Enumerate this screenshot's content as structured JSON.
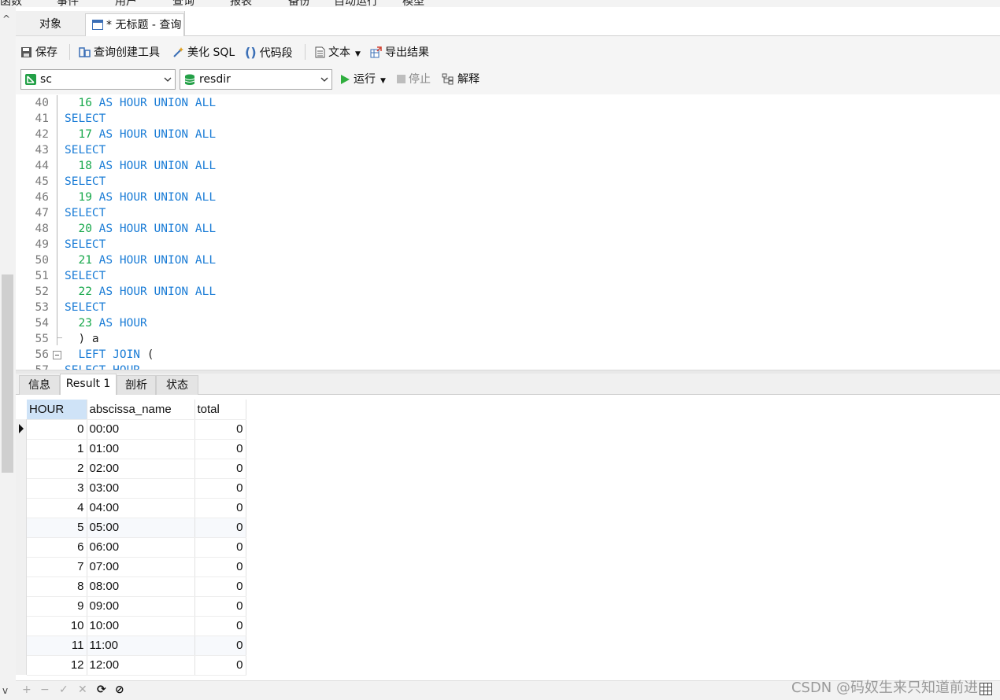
{
  "menu": [
    "函数",
    "事件",
    "用户",
    "查询",
    "报表",
    "备份",
    "自动运行",
    "模型"
  ],
  "tabs": {
    "objects": "对象",
    "query": "* 无标题 - 查询"
  },
  "toolbar": {
    "save": "保存",
    "query_builder": "查询创建工具",
    "beautify": "美化 SQL",
    "snippet": "代码段",
    "text": "文本",
    "export": "导出结果"
  },
  "toolbar2": {
    "connection": "sc",
    "database": "resdir",
    "run": "运行",
    "stop": "停止",
    "explain": "解释"
  },
  "editor_lines": [
    {
      "n": "40",
      "tokens": [
        [
          "",
          "  "
        ],
        [
          "num",
          "16"
        ],
        [
          "kw",
          " AS HOUR UNION ALL"
        ]
      ]
    },
    {
      "n": "41",
      "tokens": [
        [
          "kw",
          "SELECT"
        ]
      ]
    },
    {
      "n": "42",
      "tokens": [
        [
          "",
          "  "
        ],
        [
          "num",
          "17"
        ],
        [
          "kw",
          " AS HOUR UNION ALL"
        ]
      ]
    },
    {
      "n": "43",
      "tokens": [
        [
          "kw",
          "SELECT"
        ]
      ]
    },
    {
      "n": "44",
      "tokens": [
        [
          "",
          "  "
        ],
        [
          "num",
          "18"
        ],
        [
          "kw",
          " AS HOUR UNION ALL"
        ]
      ]
    },
    {
      "n": "45",
      "tokens": [
        [
          "kw",
          "SELECT"
        ]
      ]
    },
    {
      "n": "46",
      "tokens": [
        [
          "",
          "  "
        ],
        [
          "num",
          "19"
        ],
        [
          "kw",
          " AS HOUR UNION ALL"
        ]
      ]
    },
    {
      "n": "47",
      "tokens": [
        [
          "kw",
          "SELECT"
        ]
      ]
    },
    {
      "n": "48",
      "tokens": [
        [
          "",
          "  "
        ],
        [
          "num",
          "20"
        ],
        [
          "kw",
          " AS HOUR UNION ALL"
        ]
      ]
    },
    {
      "n": "49",
      "tokens": [
        [
          "kw",
          "SELECT"
        ]
      ]
    },
    {
      "n": "50",
      "tokens": [
        [
          "",
          "  "
        ],
        [
          "num",
          "21"
        ],
        [
          "kw",
          " AS HOUR UNION ALL"
        ]
      ]
    },
    {
      "n": "51",
      "tokens": [
        [
          "kw",
          "SELECT"
        ]
      ]
    },
    {
      "n": "52",
      "tokens": [
        [
          "",
          "  "
        ],
        [
          "num",
          "22"
        ],
        [
          "kw",
          " AS HOUR UNION ALL"
        ]
      ]
    },
    {
      "n": "53",
      "tokens": [
        [
          "kw",
          "SELECT"
        ]
      ]
    },
    {
      "n": "54",
      "tokens": [
        [
          "",
          "  "
        ],
        [
          "num",
          "23"
        ],
        [
          "kw",
          " AS HOUR"
        ]
      ]
    },
    {
      "n": "55",
      "tokens": [
        [
          "plain",
          "  ) a"
        ]
      ]
    },
    {
      "n": "56",
      "tokens": [
        [
          "kw",
          "  LEFT JOIN "
        ],
        [
          "plain",
          "("
        ]
      ]
    },
    {
      "n": "57",
      "tokens": [
        [
          "kw",
          "SELECT HOUR"
        ]
      ]
    }
  ],
  "result_tabs": [
    "信息",
    "Result 1",
    "剖析",
    "状态"
  ],
  "grid": {
    "columns": [
      "HOUR",
      "abscissa_name",
      "total"
    ],
    "rows": [
      [
        "0",
        "00:00",
        "0"
      ],
      [
        "1",
        "01:00",
        "0"
      ],
      [
        "2",
        "02:00",
        "0"
      ],
      [
        "3",
        "03:00",
        "0"
      ],
      [
        "4",
        "04:00",
        "0"
      ],
      [
        "5",
        "05:00",
        "0"
      ],
      [
        "6",
        "06:00",
        "0"
      ],
      [
        "7",
        "07:00",
        "0"
      ],
      [
        "8",
        "08:00",
        "0"
      ],
      [
        "9",
        "09:00",
        "0"
      ],
      [
        "10",
        "10:00",
        "0"
      ],
      [
        "11",
        "11:00",
        "0"
      ],
      [
        "12",
        "12:00",
        "0"
      ]
    ]
  },
  "bottom": {
    "add": "+",
    "remove": "−",
    "apply": "✓",
    "discard": "✕",
    "refresh": "⟳",
    "stop": "⊘"
  },
  "watermark": "CSDN @码奴生来只知道前进",
  "colors": {
    "keyword": "#1a7cd6",
    "number": "#18a84c",
    "header_selected": "#cfe3f7"
  }
}
